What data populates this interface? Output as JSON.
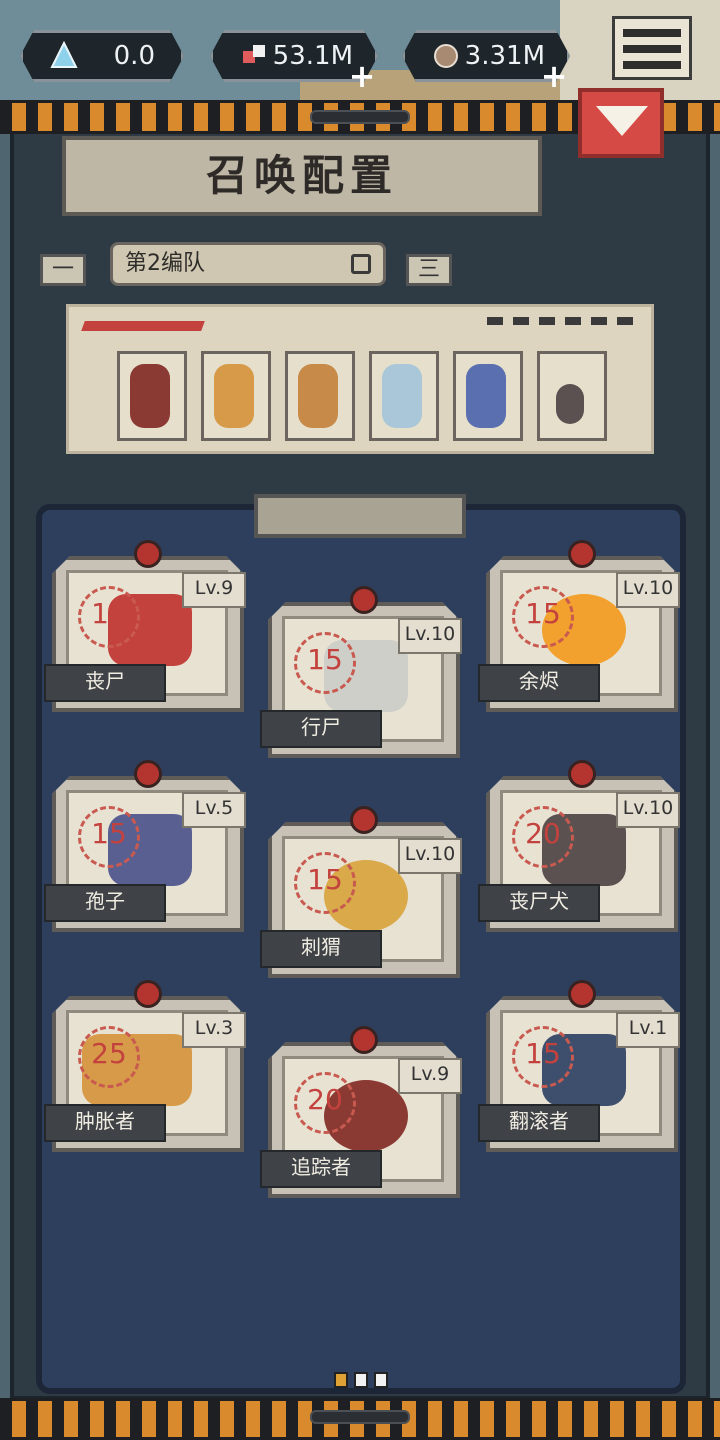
{
  "resources": {
    "crystal": {
      "value": "0.0",
      "icon": "crystal-icon"
    },
    "flesh": {
      "value": "53.1M",
      "icon": "flesh-icon"
    },
    "stone": {
      "value": "3.31M",
      "icon": "stone-icon"
    }
  },
  "header": {
    "title": "召唤配置"
  },
  "team": {
    "name": "第2编队",
    "prev_label": "一",
    "next_label": "三"
  },
  "cards": [
    {
      "name": "丧尸",
      "level": "Lv.9",
      "cost": "10",
      "color": "#c4423e"
    },
    {
      "name": "行尸",
      "level": "Lv.10",
      "cost": "15",
      "color": "#cfcfca"
    },
    {
      "name": "余烬",
      "level": "Lv.10",
      "cost": "15",
      "color": "#f2a02e"
    },
    {
      "name": "孢子",
      "level": "Lv.5",
      "cost": "15",
      "color": "#5a5f92"
    },
    {
      "name": "刺猬",
      "level": "Lv.10",
      "cost": "15",
      "color": "#d9a94a"
    },
    {
      "name": "丧尸犬",
      "level": "Lv.10",
      "cost": "20",
      "color": "#5a5150"
    },
    {
      "name": "肿胀者",
      "level": "Lv.3",
      "cost": "25",
      "color": "#d79a48"
    },
    {
      "name": "追踪者",
      "level": "Lv.9",
      "cost": "20",
      "color": "#8a3a32"
    },
    {
      "name": "翻滚者",
      "level": "Lv.1",
      "cost": "15",
      "color": "#3d4f6d"
    }
  ],
  "pagination": {
    "total": 3,
    "current": 1
  }
}
